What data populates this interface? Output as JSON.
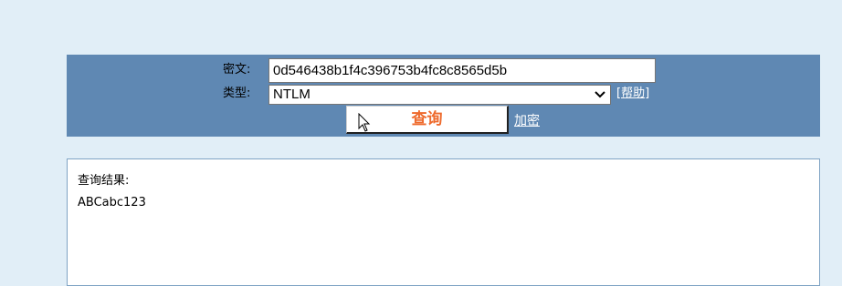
{
  "form": {
    "cipher_label": "密文:",
    "cipher_value": "0d546438b1f4c396753b4fc8c8565d5b",
    "type_label": "类型:",
    "type_selected": "NTLM",
    "help_link": "[帮助]",
    "query_button": "查询",
    "encrypt_link": "加密"
  },
  "result": {
    "title": "查询结果:",
    "value": "ABCabc123"
  },
  "icons": {
    "select_arrow": "chevron-down-icon",
    "pointer": "mouse-cursor-icon"
  },
  "colors": {
    "page_background": "#e1eef7",
    "panel_background": "#5f88b3",
    "query_text": "#ee6a2c",
    "link_text": "#ffffff"
  }
}
